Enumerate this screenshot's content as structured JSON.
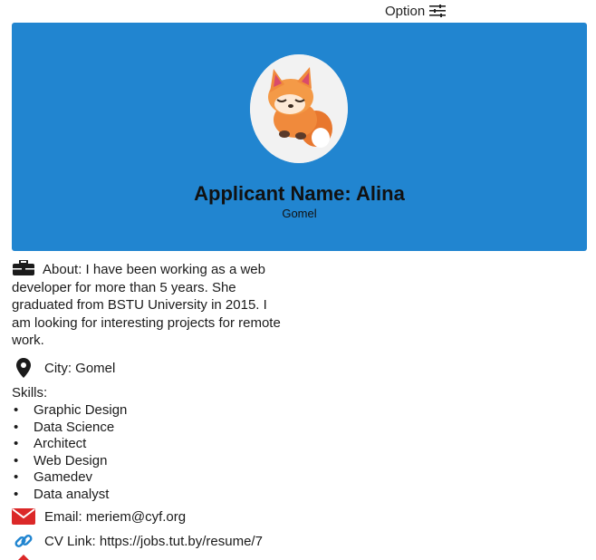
{
  "toolbar": {
    "option_label": "Option",
    "option_icon": "sliders-icon"
  },
  "profile": {
    "title": "Applicant Name: Alina",
    "subtitle": "Gomel",
    "avatar_icon": "fox-avatar",
    "about": "About: I have been working as a web developer for more than 5 years. She graduated from BSTU University in 2015. I am looking for interesting projects for remote work.",
    "city": "City: Gomel",
    "skills_label": "Skills:",
    "skills": [
      "Graphic Design",
      "Data Science",
      "Architect",
      "Web Design",
      "Gamedev",
      "Data analyst"
    ],
    "email": "Email: meriem@cyf.org",
    "cv_link": "CV Link: https://jobs.tut.by/resume/7"
  },
  "colors": {
    "hero": "#2185d0",
    "email_icon": "#db2828",
    "link_icon": "#2185d0"
  }
}
